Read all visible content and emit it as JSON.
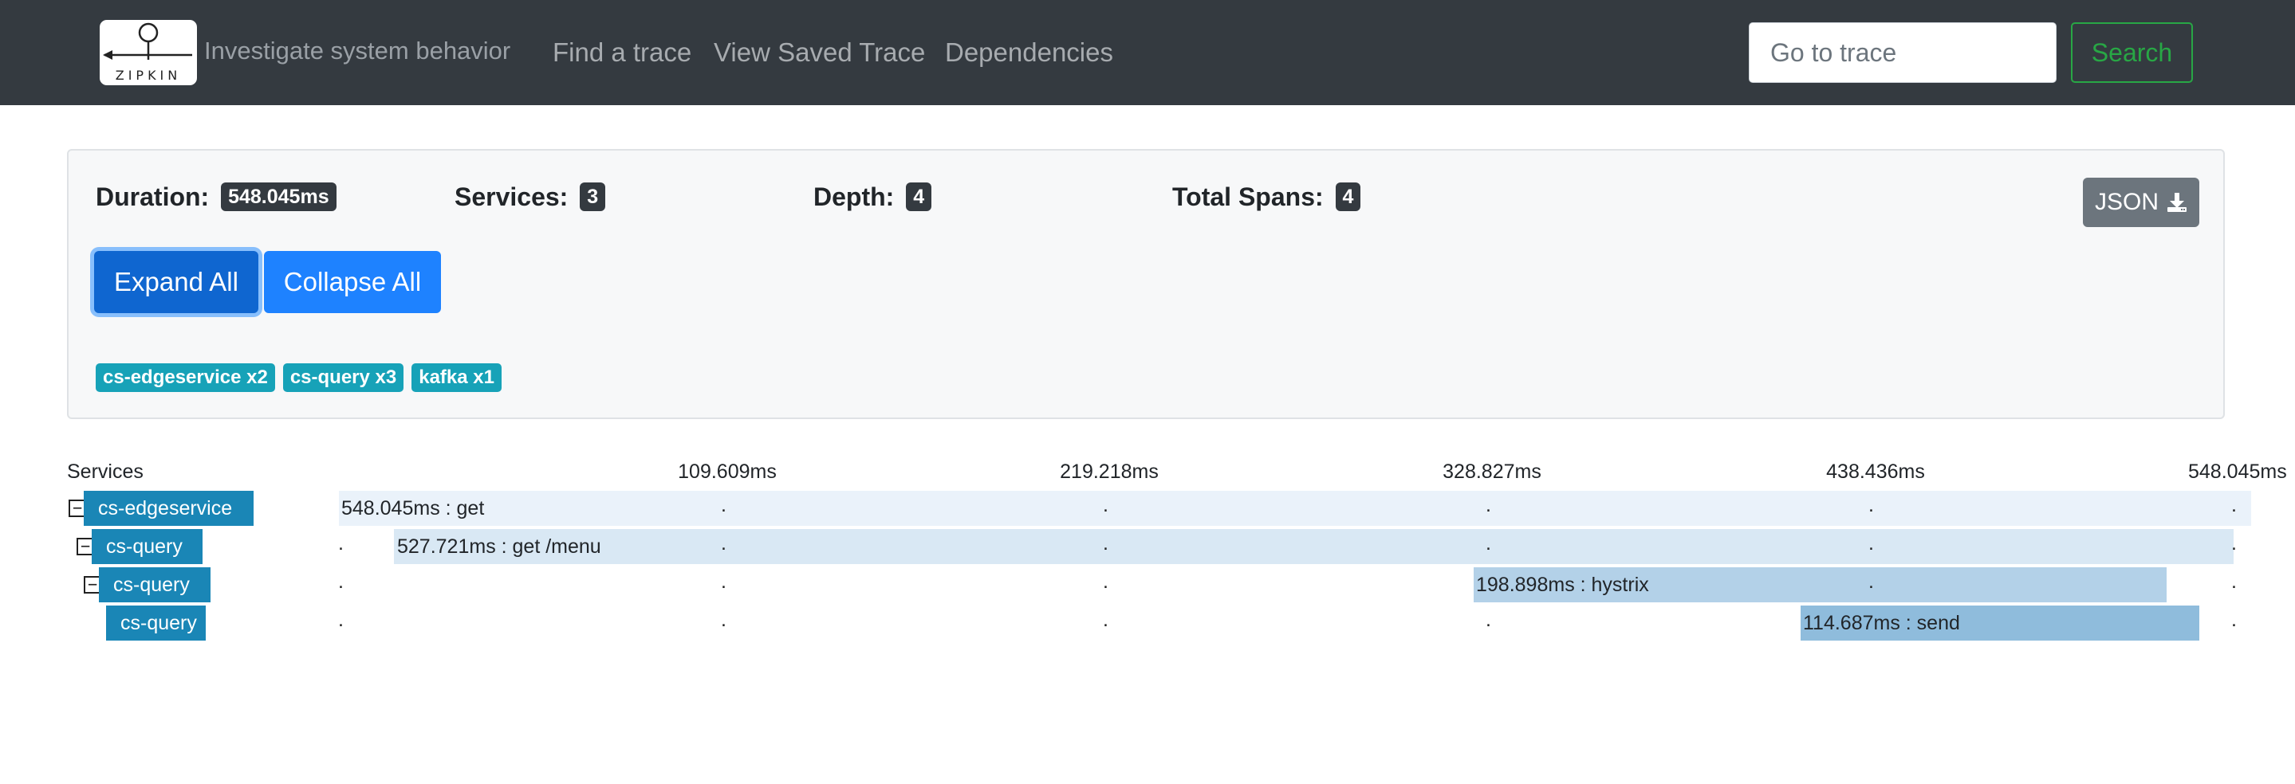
{
  "app": {
    "logo_text": "ZIPKIN",
    "tagline": "Investigate system behavior"
  },
  "nav": {
    "find_trace": "Find a trace",
    "view_saved": "View Saved Trace",
    "dependencies": "Dependencies"
  },
  "search": {
    "placeholder": "Go to trace",
    "button": "Search"
  },
  "summary": {
    "duration_label": "Duration:",
    "duration_value": "548.045ms",
    "services_label": "Services:",
    "services_value": "3",
    "depth_label": "Depth:",
    "depth_value": "4",
    "spans_label": "Total Spans:",
    "spans_value": "4",
    "json_button": "JSON",
    "expand_all": "Expand All",
    "collapse_all": "Collapse All",
    "service_tags": [
      "cs-edgeservice x2",
      "cs-query x3",
      "kafka x1"
    ]
  },
  "timeline": {
    "services_header": "Services",
    "ticks": [
      "109.609ms",
      "219.218ms",
      "328.827ms",
      "438.436ms",
      "548.045ms"
    ],
    "rows": [
      {
        "service": "cs-edgeservice",
        "span": "548.045ms : get",
        "toggle": "−"
      },
      {
        "service": "cs-query",
        "span": "527.721ms : get /menu",
        "toggle": "−"
      },
      {
        "service": "cs-query",
        "span": "198.898ms : hystrix",
        "toggle": "−"
      },
      {
        "service": "cs-query",
        "span": "114.687ms : send",
        "toggle": ""
      }
    ]
  },
  "colors": {
    "navbar": "#343a40",
    "service_label": "#1a86b6",
    "tag": "#17a2b8",
    "search_green": "#28a745"
  }
}
